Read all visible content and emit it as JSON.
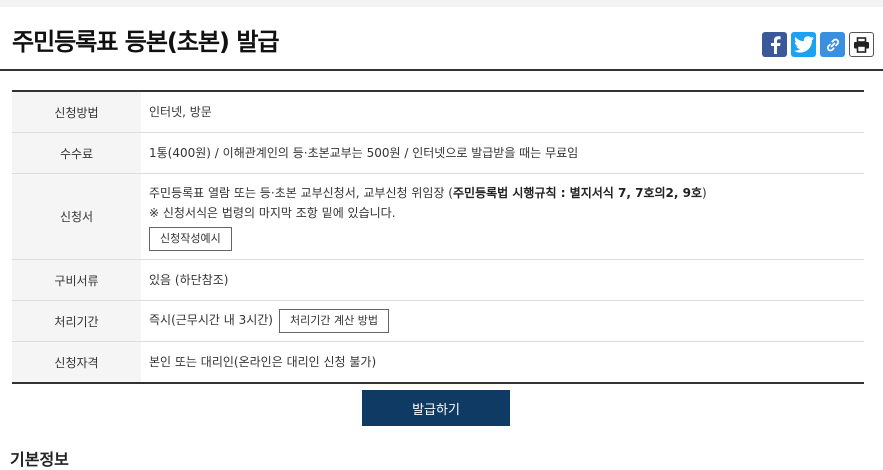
{
  "title": "주민등록표 등본(초본) 발급",
  "share": {
    "facebook_icon": "facebook-icon",
    "twitter_icon": "twitter-icon",
    "link_icon": "link-icon",
    "print_icon": "print-icon"
  },
  "rows": [
    {
      "label": "신청방법",
      "value": "인터넷, 방문"
    },
    {
      "label": "수수료",
      "value": "1통(400원) / 이해관계인의 등·초본교부는 500원 / 인터넷으로 발급받을 때는 무료임"
    },
    {
      "label": "신청서",
      "line1_prefix": "주민등록표 열람 또는 등·초본 교부신청서, 교부신청 위임장 (",
      "line1_bold": "주민등록법 시행규칙 : 별지서식 7, 7호의2, 9호",
      "line1_suffix": ")",
      "line2": "※ 신청서식은 법령의 마지막 조항 밑에 있습니다.",
      "button": "신청작성예시"
    },
    {
      "label": "구비서류",
      "value": "있음 (하단참조)"
    },
    {
      "label": "처리기간",
      "value": "즉시(근무시간 내 3시간)",
      "button": "처리기간 계산 방법"
    },
    {
      "label": "신청자격",
      "value": "본인 또는 대리인(온라인은 대리인 신청 불가)"
    }
  ],
  "issue_button": "발급하기",
  "bottom_heading": "기본정보"
}
